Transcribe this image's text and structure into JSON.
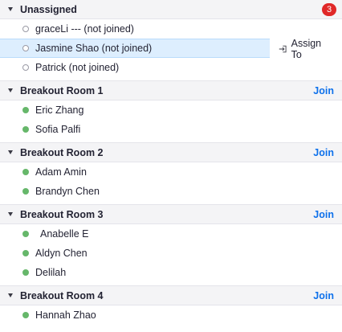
{
  "unassigned": {
    "title": "Unassigned",
    "count": "3",
    "assign_label": "Assign To",
    "participants": [
      {
        "name": "graceLi --- (not joined)"
      },
      {
        "name": "Jasmine Shao (not joined)"
      },
      {
        "name": "Patrick (not joined)"
      }
    ]
  },
  "rooms": [
    {
      "title": "Breakout Room 1",
      "join": "Join",
      "participants": [
        {
          "name": "Eric Zhang"
        },
        {
          "name": "Sofia Palfi"
        }
      ]
    },
    {
      "title": "Breakout Room 2",
      "join": "Join",
      "participants": [
        {
          "name": "Adam Amin"
        },
        {
          "name": "Brandyn Chen"
        }
      ]
    },
    {
      "title": "Breakout Room 3",
      "join": "Join",
      "participants": [
        {
          "name": "Anabelle E"
        },
        {
          "name": "Aldyn Chen"
        },
        {
          "name": "Delilah"
        }
      ]
    },
    {
      "title": "Breakout Room 4",
      "join": "Join",
      "participants": [
        {
          "name": "Hannah Zhao"
        }
      ]
    }
  ],
  "colors": {
    "accent": "#0e71eb",
    "badge": "#e02828",
    "joined_dot": "#66b76a",
    "selected_row": "#ddeefe"
  },
  "icons": {
    "collapse": "caret-down-icon",
    "not_joined": "hollow-circle-icon",
    "joined": "green-dot-icon",
    "assign": "assign-arrow-icon"
  }
}
